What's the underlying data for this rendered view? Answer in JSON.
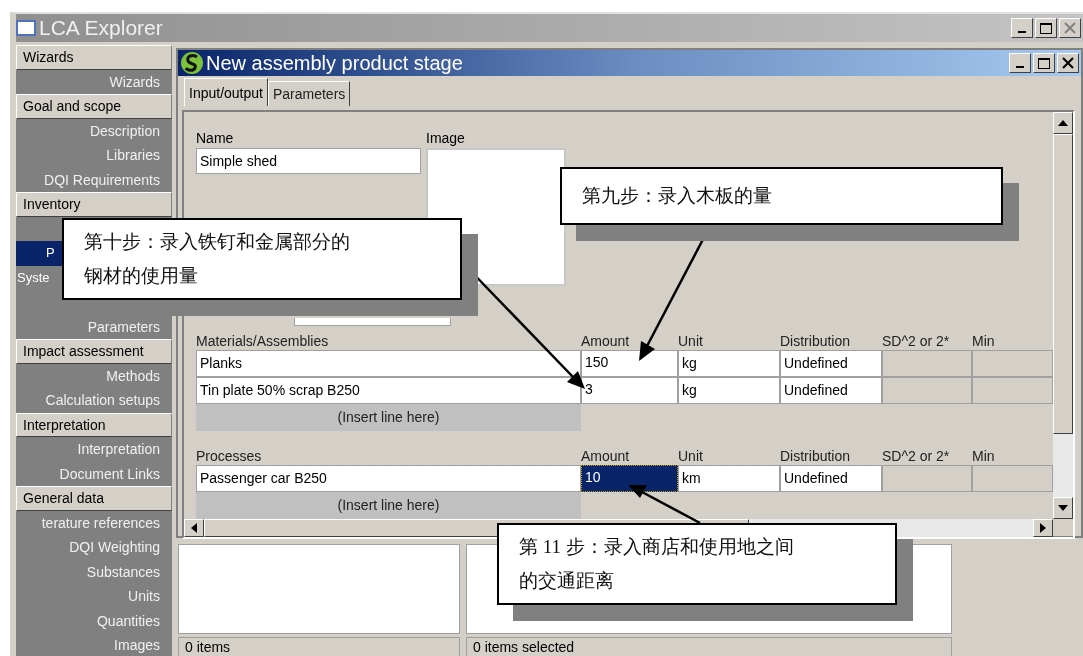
{
  "explorer": {
    "title": "LCA Explorer",
    "sidebar": [
      {
        "kind": "header",
        "label": "Wizards"
      },
      {
        "kind": "item",
        "label": "Wizards",
        "selected": false
      },
      {
        "kind": "header",
        "label": "Goal and scope"
      },
      {
        "kind": "item",
        "label": "Description",
        "selected": false
      },
      {
        "kind": "item",
        "label": "Libraries",
        "selected": false
      },
      {
        "kind": "item",
        "label": "DQI Requirements",
        "selected": false
      },
      {
        "kind": "header",
        "label": "Inventory"
      },
      {
        "kind": "covered"
      },
      {
        "kind": "item",
        "label": "P",
        "selected": true
      },
      {
        "kind": "item",
        "label": "Syste",
        "selected": false
      },
      {
        "kind": "covered"
      },
      {
        "kind": "item",
        "label": "Parameters",
        "selected": false
      },
      {
        "kind": "header",
        "label": "Impact assessment"
      },
      {
        "kind": "item",
        "label": "Methods",
        "selected": false
      },
      {
        "kind": "item",
        "label": "Calculation setups",
        "selected": false
      },
      {
        "kind": "header",
        "label": "Interpretation"
      },
      {
        "kind": "item",
        "label": "Interpretation",
        "selected": false
      },
      {
        "kind": "item",
        "label": "Document Links",
        "selected": false
      },
      {
        "kind": "header",
        "label": "General data"
      },
      {
        "kind": "item",
        "label": "terature references",
        "selected": false
      },
      {
        "kind": "item",
        "label": "DQI Weighting",
        "selected": false
      },
      {
        "kind": "item",
        "label": "Substances",
        "selected": false
      },
      {
        "kind": "item",
        "label": "Units",
        "selected": false
      },
      {
        "kind": "item",
        "label": "Quantities",
        "selected": false
      },
      {
        "kind": "item",
        "label": "Images",
        "selected": false
      }
    ],
    "status_bar": [
      "0 items",
      "0 items selected"
    ]
  },
  "child_window": {
    "title": "New assembly product stage",
    "tabs": [
      {
        "label": "Input/output",
        "selected": true
      },
      {
        "label": "Parameters",
        "selected": false
      }
    ],
    "name_label": "Name",
    "name_value": "Simple shed",
    "image_label": "Image",
    "sections": [
      {
        "columns": [
          "Materials/Assemblies",
          "Amount",
          "Unit",
          "Distribution",
          "SD^2 or 2*",
          "Min"
        ],
        "rows": [
          {
            "name": "Planks",
            "amount": {
              "text": "150",
              "selected": false
            },
            "unit": "kg",
            "distribution": "Undefined"
          },
          {
            "name": "Tin plate 50% scrap B250",
            "amount": {
              "text": "3",
              "selected": false
            },
            "unit": "kg",
            "distribution": "Undefined"
          }
        ],
        "insert_line": "(Insert line here)"
      },
      {
        "columns": [
          "Processes",
          "Amount",
          "Unit",
          "Distribution",
          "SD^2 or 2*",
          "Min"
        ],
        "rows": [
          {
            "name": "Passenger car B250",
            "amount": {
              "text": "10",
              "selected": true
            },
            "unit": "km",
            "distribution": "Undefined"
          }
        ],
        "insert_line": "(Insert line here)"
      }
    ]
  },
  "callouts": [
    {
      "lines": [
        "第九步：录入木板的量"
      ]
    },
    {
      "lines": [
        "第十步：录入铁钉和金属部分的",
        "钢材的使用量"
      ]
    },
    {
      "lines": [
        "第 11 步：录入商店和使用地之间",
        "的交通距离"
      ]
    }
  ]
}
